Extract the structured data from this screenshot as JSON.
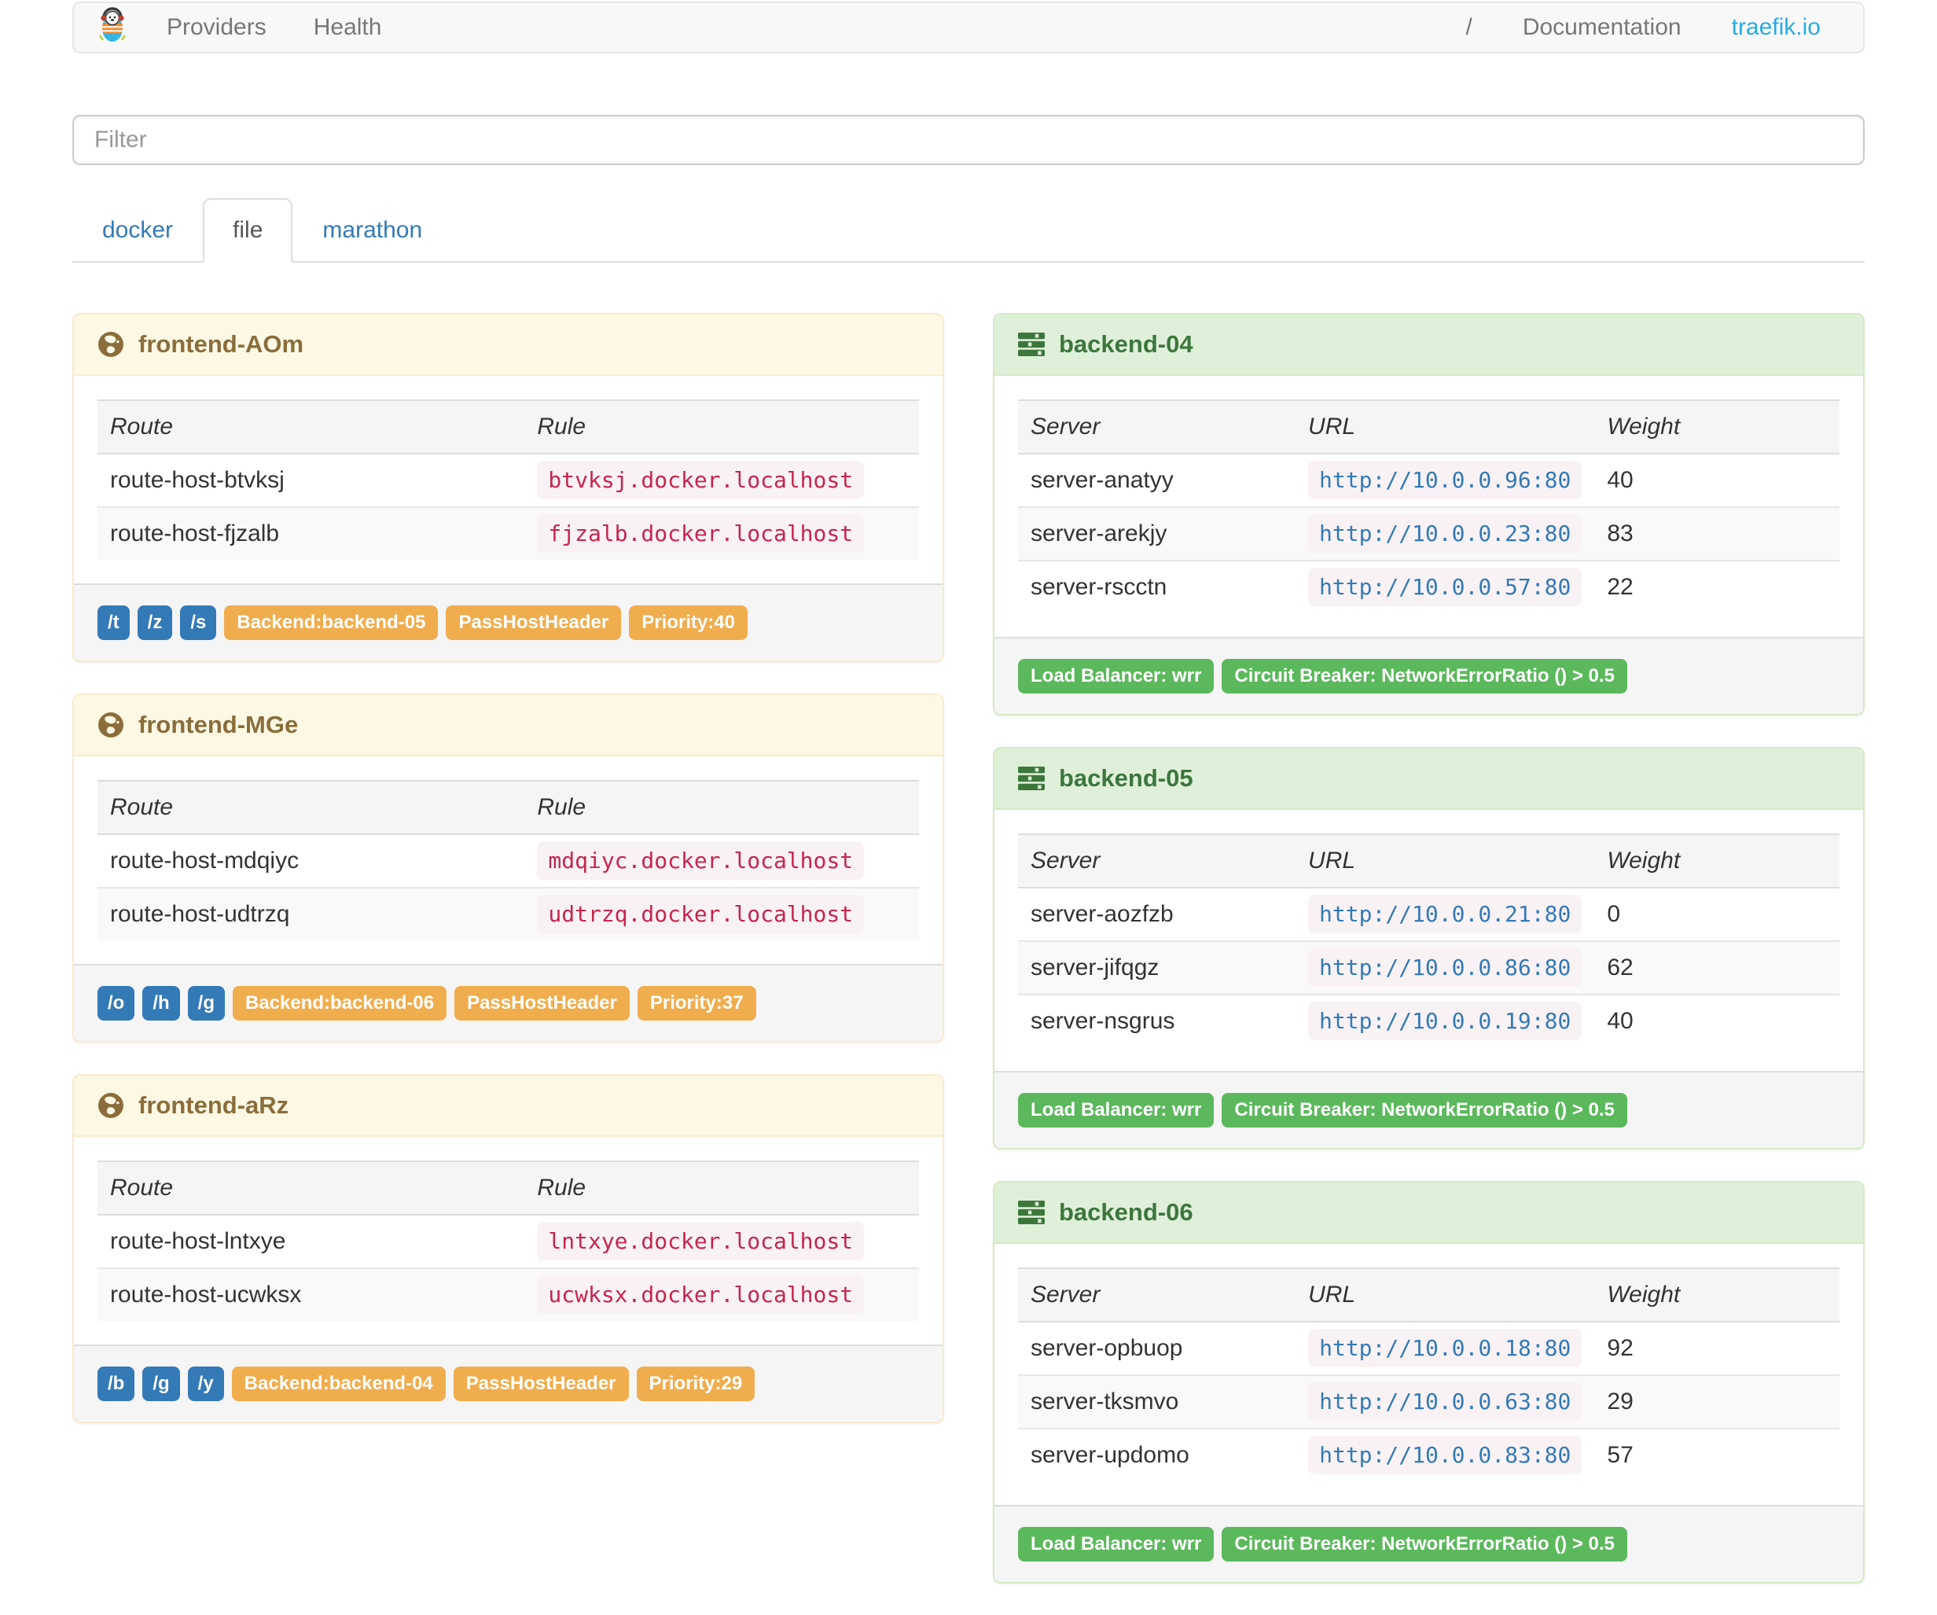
{
  "navbar": {
    "brand": "traefik-logo",
    "links_left": [
      {
        "label": "Providers"
      },
      {
        "label": "Health"
      }
    ],
    "separator": "/",
    "links_right": [
      {
        "label": "Documentation"
      },
      {
        "label": "traefik.io"
      }
    ]
  },
  "filter": {
    "placeholder": "Filter"
  },
  "tabs": [
    {
      "label": "docker",
      "active": false
    },
    {
      "label": "file",
      "active": true
    },
    {
      "label": "marathon",
      "active": false
    }
  ],
  "frontends": [
    {
      "title": "frontend-AOm",
      "columns": [
        "Route",
        "Rule"
      ],
      "routes": [
        {
          "route": "route-host-btvksj",
          "rule": "btvksj.docker.localhost"
        },
        {
          "route": "route-host-fjzalb",
          "rule": "fjzalb.docker.localhost"
        }
      ],
      "entry_points": [
        "/t",
        "/z",
        "/s"
      ],
      "badges": [
        "Backend:backend-05",
        "PassHostHeader",
        "Priority:40"
      ]
    },
    {
      "title": "frontend-MGe",
      "columns": [
        "Route",
        "Rule"
      ],
      "routes": [
        {
          "route": "route-host-mdqiyc",
          "rule": "mdqiyc.docker.localhost"
        },
        {
          "route": "route-host-udtrzq",
          "rule": "udtrzq.docker.localhost"
        }
      ],
      "entry_points": [
        "/o",
        "/h",
        "/g"
      ],
      "badges": [
        "Backend:backend-06",
        "PassHostHeader",
        "Priority:37"
      ]
    },
    {
      "title": "frontend-aRz",
      "columns": [
        "Route",
        "Rule"
      ],
      "routes": [
        {
          "route": "route-host-lntxye",
          "rule": "lntxye.docker.localhost"
        },
        {
          "route": "route-host-ucwksx",
          "rule": "ucwksx.docker.localhost"
        }
      ],
      "entry_points": [
        "/b",
        "/g",
        "/y"
      ],
      "badges": [
        "Backend:backend-04",
        "PassHostHeader",
        "Priority:29"
      ]
    }
  ],
  "backends": [
    {
      "title": "backend-04",
      "columns": [
        "Server",
        "URL",
        "Weight"
      ],
      "servers": [
        {
          "server": "server-anatyy",
          "url": "http://10.0.0.96:80",
          "weight": "40"
        },
        {
          "server": "server-arekjy",
          "url": "http://10.0.0.23:80",
          "weight": "83"
        },
        {
          "server": "server-rscctn",
          "url": "http://10.0.0.57:80",
          "weight": "22"
        }
      ],
      "badges": [
        "Load Balancer: wrr",
        "Circuit Breaker: NetworkErrorRatio () > 0.5"
      ]
    },
    {
      "title": "backend-05",
      "columns": [
        "Server",
        "URL",
        "Weight"
      ],
      "servers": [
        {
          "server": "server-aozfzb",
          "url": "http://10.0.0.21:80",
          "weight": "0"
        },
        {
          "server": "server-jifqgz",
          "url": "http://10.0.0.86:80",
          "weight": "62"
        },
        {
          "server": "server-nsgrus",
          "url": "http://10.0.0.19:80",
          "weight": "40"
        }
      ],
      "badges": [
        "Load Balancer: wrr",
        "Circuit Breaker: NetworkErrorRatio () > 0.5"
      ]
    },
    {
      "title": "backend-06",
      "columns": [
        "Server",
        "URL",
        "Weight"
      ],
      "servers": [
        {
          "server": "server-opbuop",
          "url": "http://10.0.0.18:80",
          "weight": "92"
        },
        {
          "server": "server-tksmvo",
          "url": "http://10.0.0.63:80",
          "weight": "29"
        },
        {
          "server": "server-updomo",
          "url": "http://10.0.0.83:80",
          "weight": "57"
        }
      ],
      "badges": [
        "Load Balancer: wrr",
        "Circuit Breaker: NetworkErrorRatio () > 0.5"
      ]
    }
  ],
  "colors": {
    "brand_link": "#29abe2",
    "link": "#337ab7",
    "label_primary": "#337ab7",
    "label_warning": "#f0ad4e",
    "label_success": "#5cb85c",
    "frontend_header_bg": "#fcf8e3",
    "frontend_header_text": "#8a6d3b",
    "backend_header_bg": "#dff0d8",
    "backend_header_text": "#3c763d",
    "code_bg": "#f9f2f4",
    "code_text": "#c7254e",
    "url_text": "#337ab7"
  }
}
